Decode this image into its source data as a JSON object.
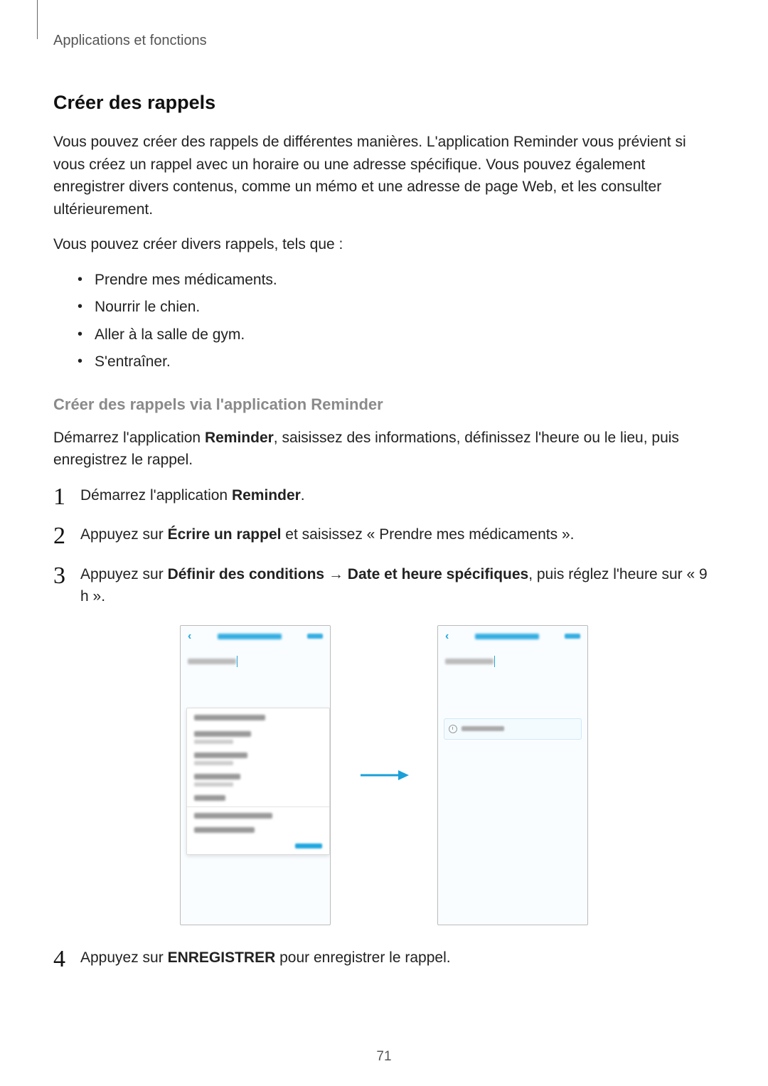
{
  "breadcrumb": "Applications et fonctions",
  "section_title": "Créer des rappels",
  "intro_paragraph": "Vous pouvez créer des rappels de différentes manières. L'application Reminder vous prévient si vous créez un rappel avec un horaire ou une adresse spécifique. Vous pouvez également enregistrer divers contenus, comme un mémo et une adresse de page Web, et les consulter ultérieurement.",
  "examples_lead": "Vous pouvez créer divers rappels, tels que :",
  "bullets": [
    "Prendre mes médicaments.",
    "Nourrir le chien.",
    "Aller à la salle de gym.",
    "S'entraîner."
  ],
  "subheading": "Créer des rappels via l'application Reminder",
  "sub_paragraph_pre": "Démarrez l'application ",
  "sub_paragraph_bold1": "Reminder",
  "sub_paragraph_post": ", saisissez des informations, définissez l'heure ou le lieu, puis enregistrez le rappel.",
  "step1_pre": "Démarrez l'application ",
  "step1_bold": "Reminder",
  "step1_post": ".",
  "step2_pre": "Appuyez sur ",
  "step2_bold": "Écrire un rappel",
  "step2_post": " et saisissez « Prendre mes médicaments ».",
  "step3_pre": "Appuyez sur ",
  "step3_bold1": "Définir des conditions",
  "step3_arrow": " → ",
  "step3_bold2": "Date et heure spécifiques",
  "step3_post": ", puis réglez l'heure sur « 9 h ».",
  "step4_pre": "Appuyez sur ",
  "step4_bold": "ENREGISTRER",
  "step4_post": " pour enregistrer le rappel.",
  "page_number": "71"
}
